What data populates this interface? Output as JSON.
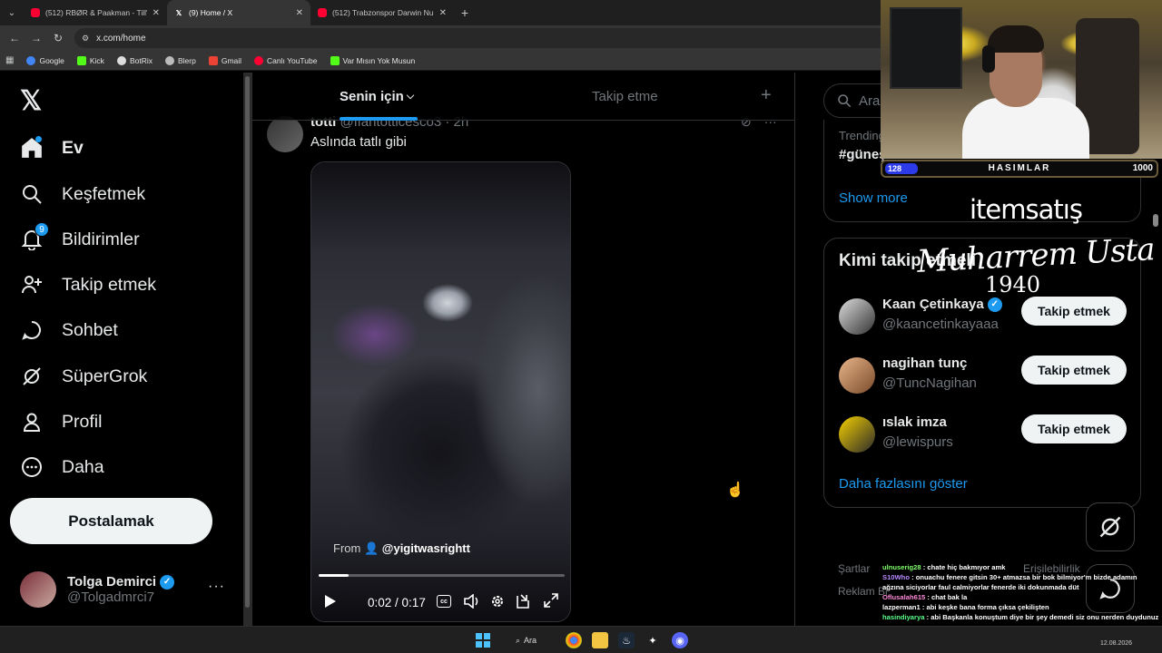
{
  "browser": {
    "tabs": [
      {
        "title": "(512) RBØR & Paakman - Till' M",
        "icon": "youtube"
      },
      {
        "title": "(9) Home / X",
        "icon": "x"
      },
      {
        "title": "(512) Trabzonspor Darwin Nun",
        "icon": "youtube"
      }
    ],
    "url": "x.com/home",
    "bookmarks": [
      "Google",
      "Kick",
      "BotRix",
      "Blerp",
      "Gmail",
      "Canlı YouTube",
      "Var Mısın Yok Musun"
    ]
  },
  "nav": {
    "items": [
      {
        "label": "Ev",
        "icon": "home-icon"
      },
      {
        "label": "Keşfetmek",
        "icon": "search-icon"
      },
      {
        "label": "Bildirimler",
        "icon": "bell-icon",
        "badge": "9"
      },
      {
        "label": "Takip etmek",
        "icon": "person-add-icon"
      },
      {
        "label": "Sohbet",
        "icon": "chat-icon"
      },
      {
        "label": "SüperGrok",
        "icon": "grok-icon"
      },
      {
        "label": "Profil",
        "icon": "profile-icon"
      },
      {
        "label": "Daha",
        "icon": "more-circle-icon"
      }
    ],
    "post_button": "Postalamak",
    "account": {
      "name": "Tolga Demirci",
      "handle": "@Tolgadmrci7"
    }
  },
  "timeline": {
    "tab_foryou": "Senin için",
    "tab_following": "Takip etme",
    "post": {
      "author": "totti",
      "handle": "@ffantotticesco3",
      "time": "2h",
      "text": "Aslında tatlı gibi",
      "video": {
        "from_label": "From",
        "from_user": "@yigitwasrightt",
        "current_time": "0:02",
        "duration": "0:17",
        "progress_fraction": 0.12
      }
    }
  },
  "sidebar": {
    "search_placeholder": "Ara",
    "trends": {
      "small": "Trending",
      "tag": "#güneştutulması",
      "show_more": "Show more"
    },
    "who_to_follow": {
      "title": "Kimi takip etmeli",
      "users": [
        {
          "name": "Kaan Çetinkaya",
          "handle": "@kaancetinkayaaa",
          "verified": true,
          "button": "Takip etmek"
        },
        {
          "name": "nagihan tunç",
          "handle": "@TuncNagihan",
          "verified": false,
          "button": "Takip etmek"
        },
        {
          "name": "ıslak imza",
          "handle": "@lewispurs",
          "verified": false,
          "button": "Takip etmek"
        }
      ],
      "more": "Daha fazlasını göster"
    },
    "footer": {
      "terms": "Şartlar",
      "accessibility": "Erişilebilirlik",
      "ads": "Reklam Bi"
    }
  },
  "stream": {
    "bar_level": "128",
    "bar_title": "HASIMLAR",
    "bar_max": "1000",
    "sponsor": "itemsatış",
    "signature": "Muharrem Usta",
    "signature_year": "1940",
    "chat": [
      {
        "user": "ulnuserig28",
        "msg": ": chate hiç bakmıyor amk"
      },
      {
        "user": "S10Who",
        "msg": ": onuachu fenere gitsin 30+ atmazsa bir bok bilmiyor'm bizde adamın ağzına siciyorlar faul calmiyorlar fenerde iki dokunmada düt"
      },
      {
        "user": "Oflusalah615",
        "msg": ": chat bak la"
      },
      {
        "user": "lazperman1",
        "msg": ": abi keşke bana forma çıksa çekilişten"
      },
      {
        "user": "hasindiyarya",
        "msg": ": abi Başkanla konuştum diye bir şey demedi siz onu nerden duydunuz"
      }
    ]
  },
  "taskbar": {
    "search": "Ara",
    "date": "12.08.2026"
  },
  "colors": {
    "accent": "#1d9bf0",
    "bg": "#000000",
    "border": "#2f3336",
    "muted": "#71767b"
  }
}
